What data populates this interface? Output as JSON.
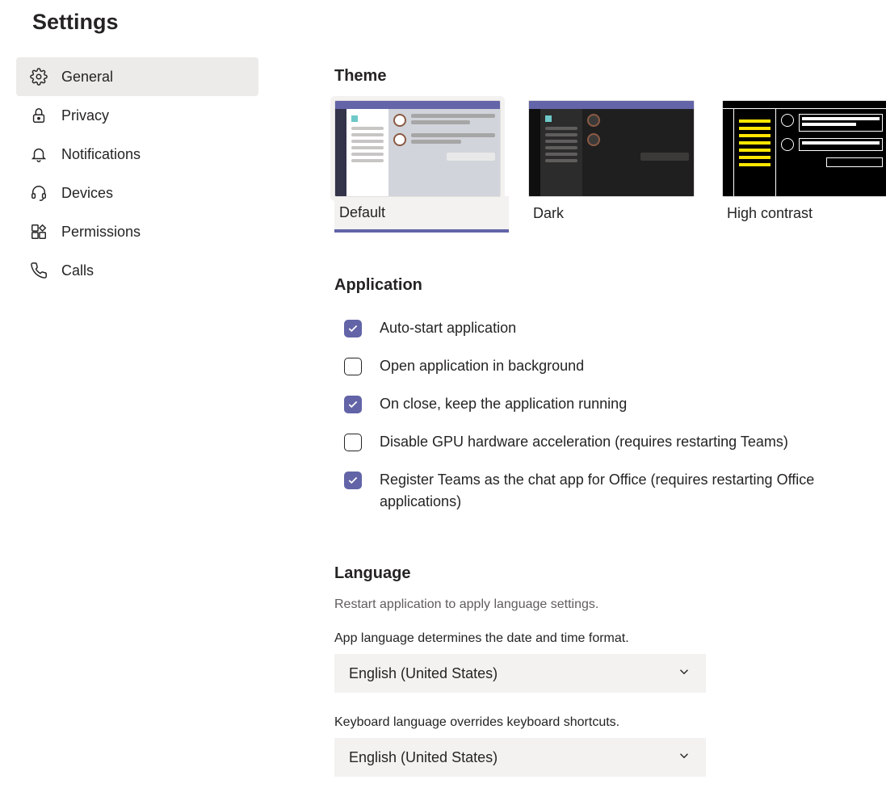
{
  "page_title": "Settings",
  "sidebar": {
    "items": [
      {
        "label": "General",
        "icon": "gear",
        "active": true
      },
      {
        "label": "Privacy",
        "icon": "lock",
        "active": false
      },
      {
        "label": "Notifications",
        "icon": "bell",
        "active": false
      },
      {
        "label": "Devices",
        "icon": "headset",
        "active": false
      },
      {
        "label": "Permissions",
        "icon": "apps",
        "active": false
      },
      {
        "label": "Calls",
        "icon": "phone",
        "active": false
      }
    ]
  },
  "sections": {
    "theme": {
      "title": "Theme",
      "options": [
        {
          "label": "Default",
          "selected": true
        },
        {
          "label": "Dark",
          "selected": false
        },
        {
          "label": "High contrast",
          "selected": false
        }
      ]
    },
    "application": {
      "title": "Application",
      "checks": [
        {
          "label": "Auto-start application",
          "checked": true
        },
        {
          "label": "Open application in background",
          "checked": false
        },
        {
          "label": "On close, keep the application running",
          "checked": true
        },
        {
          "label": "Disable GPU hardware acceleration (requires restarting Teams)",
          "checked": false
        },
        {
          "label": "Register Teams as the chat app for Office (requires restarting Office applications)",
          "checked": true
        }
      ]
    },
    "language": {
      "title": "Language",
      "restart_note": "Restart application to apply language settings.",
      "app_lang_note": "App language determines the date and time format.",
      "app_lang_value": "English (United States)",
      "kb_lang_note": "Keyboard language overrides keyboard shortcuts.",
      "kb_lang_value": "English (United States)"
    }
  }
}
